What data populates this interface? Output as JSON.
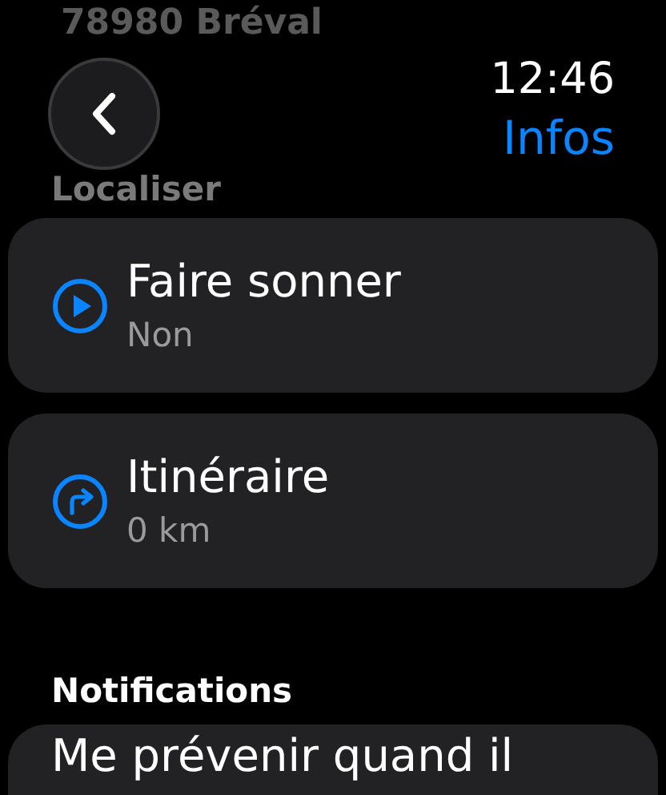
{
  "header": {
    "location": "78980 Bréval",
    "time": "12:46",
    "title": "Infos",
    "section": "Localiser"
  },
  "actions": [
    {
      "kind": "play",
      "title": "Faire sonner",
      "value": "Non"
    },
    {
      "kind": "directions",
      "title": "Itinéraire",
      "value": "0 km"
    }
  ],
  "notifications": {
    "heading": "Notifications",
    "option": "Me prévenir quand il"
  }
}
